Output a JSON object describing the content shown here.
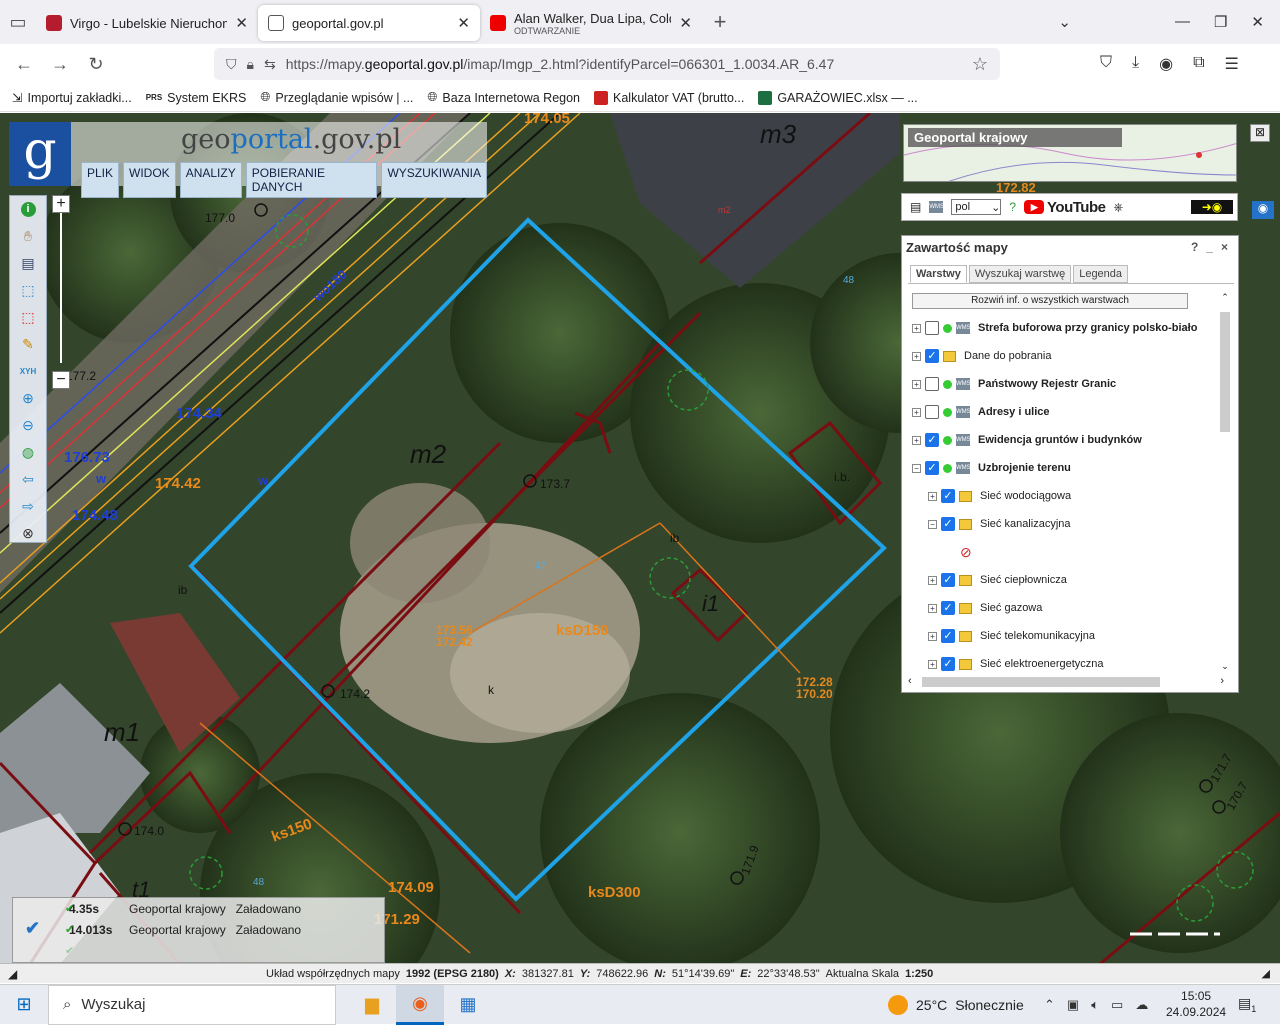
{
  "browser": {
    "tabs": [
      {
        "title": "Virgo - Lubelskie Nieruchomoś",
        "icon": "virgo-icon",
        "color": "#b51d2e"
      },
      {
        "title": "geoportal.gov.pl",
        "icon": "page-icon",
        "color": "#555555"
      },
      {
        "title": "Alan Walker, Dua Lipa, Coldplay",
        "subtitle": "ODTWARZANIE",
        "icon": "youtube-icon",
        "color": "#ee0000"
      }
    ],
    "url_prefix": "https://mapy.",
    "url_domain": "geoportal.gov.pl",
    "url_suffix": "/imap/Imgp_2.html?identifyParcel=066301_1.0034.AR_6.47",
    "bookmarks": [
      {
        "label": "Importuj zakładki...",
        "icon": "import-icon"
      },
      {
        "label": "System EKRS",
        "icon": "ekrs-icon"
      },
      {
        "label": "Przeglądanie wpisów | ...",
        "icon": "globe-icon"
      },
      {
        "label": "Baza Internetowa Regon",
        "icon": "globe-icon"
      },
      {
        "label": "Kalkulator VAT (brutto...",
        "icon": "calculator-icon"
      },
      {
        "label": "GARAŻOWIEC.xlsx — ...",
        "icon": "excel-icon"
      }
    ]
  },
  "geoportal": {
    "logo_letter": "g",
    "logo_text_a": "geo",
    "logo_text_b": "portal",
    "logo_text_c": ".gov.pl",
    "menu": [
      "PLIK",
      "WIDOK",
      "ANALIZY",
      "POBIERANIE DANYCH",
      "WYSZUKIWANIA"
    ],
    "minimap_label": "Geoportal krajowy",
    "language": "pol",
    "youtube_label": "YouTube"
  },
  "layers_panel": {
    "title": "Zawartość mapy",
    "controls": [
      "?",
      "_",
      "×"
    ],
    "tabs": [
      "Warstwy",
      "Wyszukaj warstwę",
      "Legenda"
    ],
    "expand_all": "Rozwiń inf. o wszystkich warstwach",
    "items": [
      {
        "label": "Strefa buforowa przy granicy polsko-biało",
        "checked": false,
        "kind": "wms",
        "bold": true,
        "indent": 0,
        "toggle": "+"
      },
      {
        "label": "Dane do pobrania",
        "checked": true,
        "kind": "folder",
        "bold": false,
        "indent": 0,
        "toggle": "+"
      },
      {
        "label": "Państwowy Rejestr Granic",
        "checked": false,
        "kind": "wms",
        "bold": true,
        "indent": 0,
        "toggle": "+"
      },
      {
        "label": "Adresy i ulice",
        "checked": false,
        "kind": "wms",
        "bold": true,
        "indent": 0,
        "toggle": "+"
      },
      {
        "label": "Ewidencja gruntów i budynków",
        "checked": true,
        "kind": "wms",
        "bold": true,
        "indent": 0,
        "toggle": "+"
      },
      {
        "label": "Uzbrojenie terenu",
        "checked": true,
        "kind": "wms",
        "bold": true,
        "indent": 0,
        "toggle": "−"
      },
      {
        "label": "Sieć wodociągowa",
        "checked": true,
        "kind": "folder",
        "bold": false,
        "indent": 1,
        "toggle": "+"
      },
      {
        "label": "Sieć kanalizacyjna",
        "checked": true,
        "kind": "folder",
        "bold": false,
        "indent": 1,
        "toggle": "−"
      },
      {
        "label": "",
        "checked": false,
        "kind": "legend",
        "bold": false,
        "indent": 2,
        "toggle": ""
      },
      {
        "label": "Sieć ciepłownicza",
        "checked": true,
        "kind": "folder",
        "bold": false,
        "indent": 1,
        "toggle": "+"
      },
      {
        "label": "Sieć gazowa",
        "checked": true,
        "kind": "folder",
        "bold": false,
        "indent": 1,
        "toggle": "+"
      },
      {
        "label": "Sieć telekomunikacyjna",
        "checked": true,
        "kind": "folder",
        "bold": false,
        "indent": 1,
        "toggle": "+"
      },
      {
        "label": "Sieć elektroenergetyczna",
        "checked": true,
        "kind": "folder",
        "bold": false,
        "indent": 1,
        "toggle": "+"
      }
    ]
  },
  "status_log": [
    {
      "time": "4.35s",
      "source": "Geoportal krajowy",
      "state": "Załadowano"
    },
    {
      "time": "14.013s",
      "source": "Geoportal krajowy",
      "state": "Załadowano"
    },
    {
      "time": "",
      "source": "",
      "state": ""
    }
  ],
  "coords": {
    "system": "Układ współrzędnych mapy",
    "system_value": "1992 (EPSG 2180)",
    "x_label": "X:",
    "x_value": "381327.81",
    "y_label": "Y:",
    "y_value": "748622.96",
    "n_label": "N:",
    "n_value": "51°14'39.69\"",
    "e_label": "E:",
    "e_value": "22°33'48.53\"",
    "scale_label": "Aktualna Skala",
    "scale_value": "1:250"
  },
  "map_labels": {
    "m1": "m1",
    "m2": "m2",
    "m3": "m3",
    "i1": "i1",
    "t1": "t1",
    "wo180": "wo180",
    "ksD150": "ksD150",
    "ks150": "ks150",
    "ksD300": "ksD300",
    "h174_05": "174.05",
    "h172_82": "172.82",
    "h176_73": "176.73",
    "h174_34": "174.34",
    "h174_48": "174.48",
    "h174_42": "174.42",
    "h173_7": "173.7",
    "h174_2": "174.2",
    "h174_0": "174.0",
    "h174_09": "174.09",
    "h171_29": "171.29",
    "h173_56": "173.56",
    "h172_42": "172.42",
    "h172_28": "172.28",
    "h170_20": "170.20",
    "h171_9": "171.9",
    "h177_0": "177.0",
    "h177_2": "177.2",
    "h171_7": "171.7",
    "h170_7": "170.7",
    "w1": "w",
    "w2": "w",
    "k1": "k",
    "ib1": "ib",
    "ib2": "ib",
    "ib3": "i.b.",
    "n48a": "48",
    "n48b": "48",
    "n47": "47",
    "m2small": "m2"
  },
  "taskbar": {
    "search_placeholder": "Wyszukaj",
    "weather_temp": "25°C",
    "weather_desc": "Słonecznie",
    "time": "15:05",
    "date": "24.09.2024",
    "notifications": "1"
  }
}
